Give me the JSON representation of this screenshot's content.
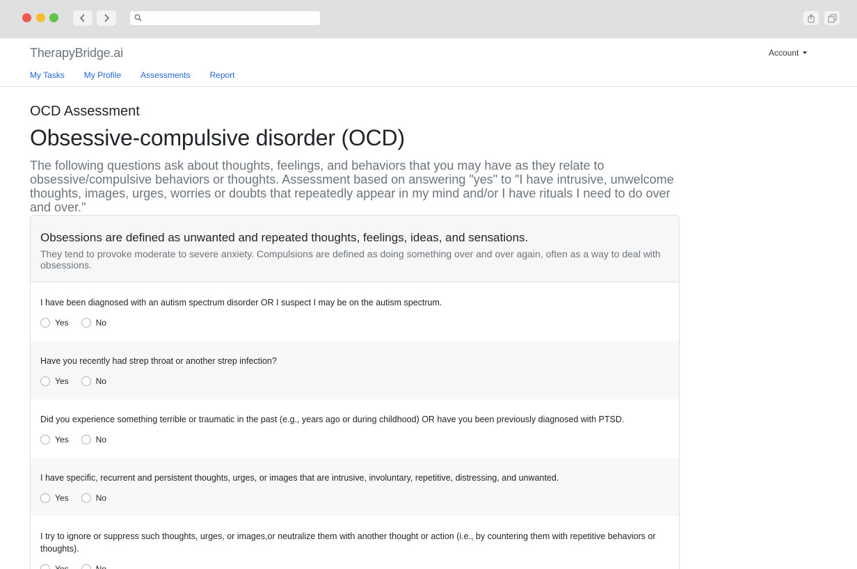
{
  "browser": {
    "url": ""
  },
  "header": {
    "brand": "TherapyBridge.ai",
    "account_label": "Account",
    "nav": [
      "My Tasks",
      "My Profile",
      "Assessments",
      "Report"
    ]
  },
  "page": {
    "subtitle": "OCD Assessment",
    "title": "Obsessive-compulsive disorder (OCD)",
    "lead": "The following questions ask about thoughts, feelings, and behaviors that you may have as they relate to obsessive/compulsive behaviors or thoughts. Assessment based on answering \"yes\" to \"I have intrusive, unwelcome thoughts, images, urges, worries or doubts that repeatedly appear in my mind and/or I have rituals I need to do over and over.\""
  },
  "card": {
    "title": "Obsessions are defined as unwanted and repeated thoughts, feelings, ideas, and sensations.",
    "subtitle": "They tend to provoke moderate to severe anxiety. Compulsions are defined as doing something over and over again, often as a way to deal with obsessions.",
    "yes_label": "Yes",
    "no_label": "No",
    "questions": [
      "I have been diagnosed with an autism spectrum disorder OR I suspect I may be on the autism spectrum.",
      "Have you recently had strep throat or another strep infection?",
      "Did you experience something terrible or traumatic in the past (e.g., years ago or during childhood) OR have you been previously diagnosed with PTSD.",
      "I have specific, recurrent and persistent thoughts, urges, or images that are intrusive, involuntary, repetitive, distressing, and unwanted.",
      "I try to ignore or suppress such thoughts, urges, or images,or neutralize them with another thought or action (i.e., by countering them with repetitive behaviors or thoughts)."
    ]
  },
  "colors": {
    "link": "#2566d8",
    "muted": "#6c757d"
  }
}
